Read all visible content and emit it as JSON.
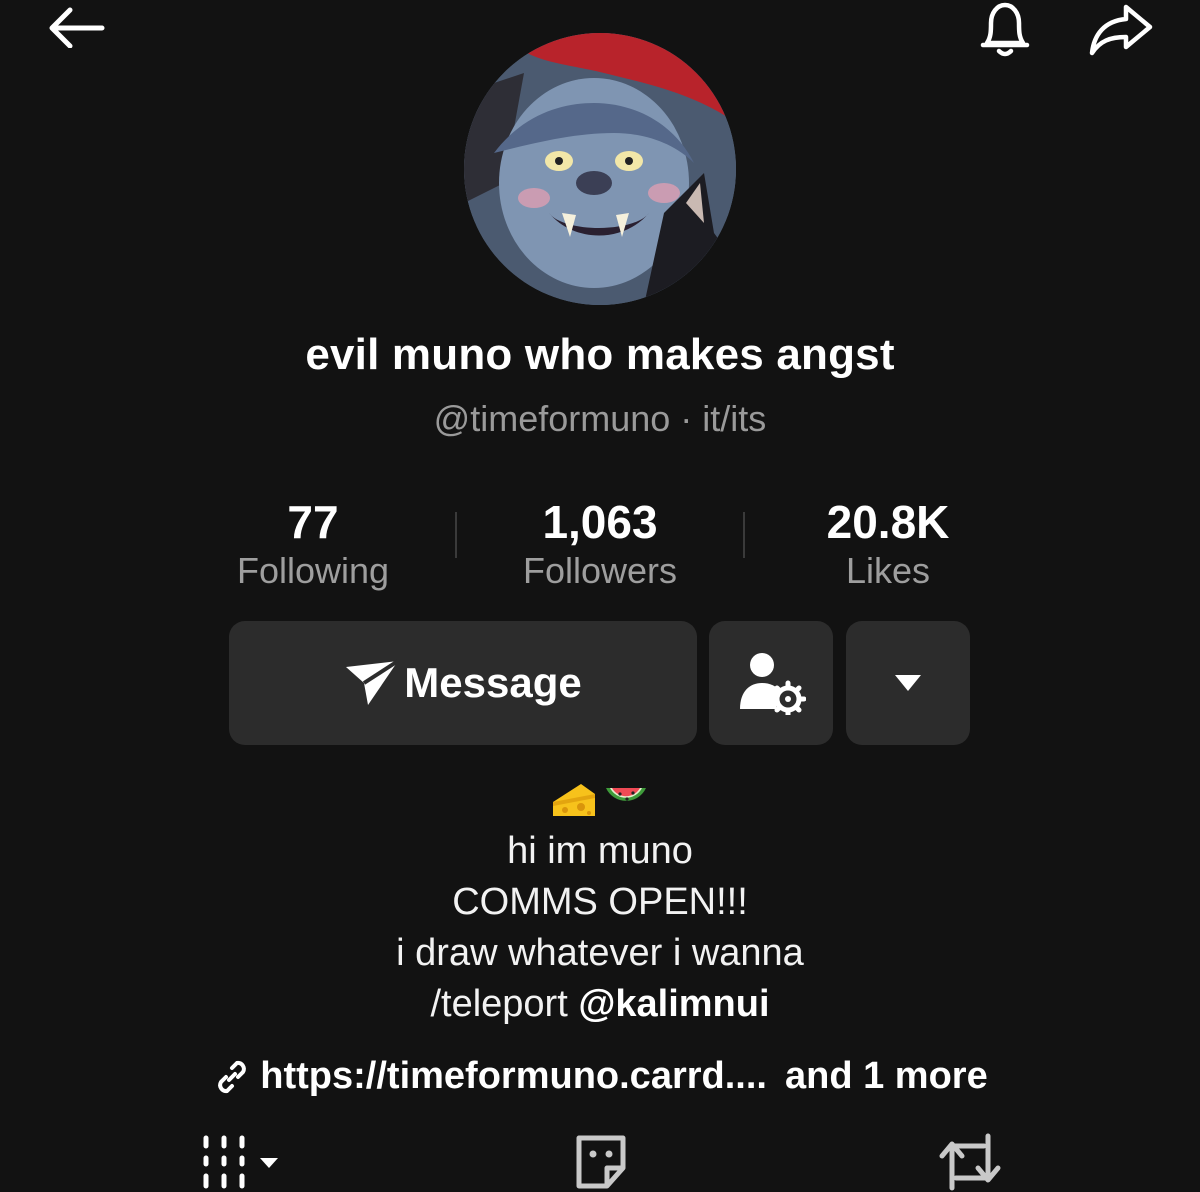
{
  "profile": {
    "display_name": "evil muno who makes angst",
    "handle": "@timeformuno",
    "pronouns_sep": " · ",
    "pronouns": "it/its"
  },
  "stats": [
    {
      "value": "77",
      "label": "Following"
    },
    {
      "value": "1,063",
      "label": "Followers"
    },
    {
      "value": "20.8K",
      "label": "Likes"
    }
  ],
  "actions": {
    "message_label": "Message"
  },
  "bio": {
    "emoji": [
      "🧀",
      "🍉"
    ],
    "line1": "hi im muno",
    "line2": "COMMS OPEN!!!",
    "line3": "i draw whatever i wanna",
    "line4_prefix": "/teleport ",
    "line4_mention": "@kalimnui"
  },
  "link": {
    "url": "https://timeformuno.carrd....",
    "more": "and 1 more"
  },
  "icons": {
    "header": [
      "back-arrow-icon",
      "bell-icon",
      "share-icon"
    ],
    "tabs": [
      "videos-grid-icon",
      "favorites-icon",
      "repost-icon"
    ]
  },
  "colors": {
    "background": "#121212",
    "button_bg": "#2c2c2c",
    "secondary_text": "#9a9a9a"
  }
}
